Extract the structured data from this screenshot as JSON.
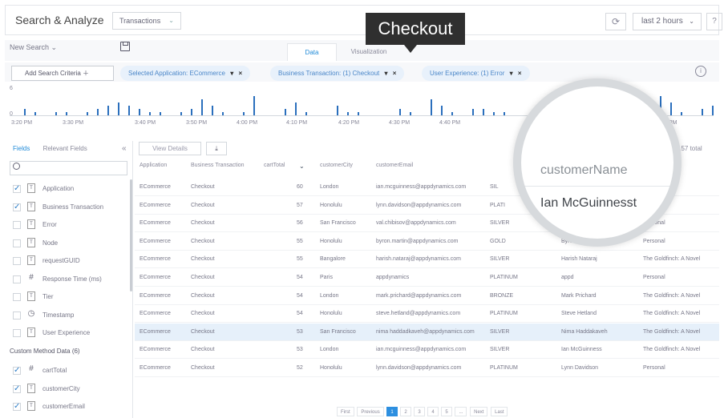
{
  "app": {
    "title": "Search & Analyze"
  },
  "header": {
    "transactions_label": "Transactions",
    "time_range": "last 2 hours",
    "help": "?"
  },
  "toolbar": {
    "new_search": "New Search",
    "tab_data": "Data",
    "tab_visualization": "Visualization"
  },
  "criteria": {
    "add_label": "Add Search Criteria",
    "chips": [
      "Selected Application: ECommerce",
      "Business Transaction: (1) Checkout",
      "User Experience: (1) Error"
    ]
  },
  "callout": {
    "text": "Checkout"
  },
  "histogram": {
    "y_ticks": [
      "6",
      "0"
    ],
    "x_ticks": [
      "3:20 PM",
      "3:30 PM",
      "3:40 PM",
      "3:50 PM",
      "4:00 PM",
      "4:10 PM",
      "4:20 PM",
      "4:30 PM",
      "4:40 PM",
      "PM"
    ]
  },
  "left_panel": {
    "tab_fields": "Fields",
    "tab_relevant": "Relevant Fields",
    "collapse": "«",
    "fields": [
      {
        "label": "Application",
        "checked": true,
        "icon": "T"
      },
      {
        "label": "Business Transaction",
        "checked": true,
        "icon": "T"
      },
      {
        "label": "Error",
        "checked": false,
        "icon": "T"
      },
      {
        "label": "Node",
        "checked": false,
        "icon": "T"
      },
      {
        "label": "requestGUID",
        "checked": false,
        "icon": "T"
      },
      {
        "label": "Response Time (ms)",
        "checked": false,
        "icon": "#"
      },
      {
        "label": "Tier",
        "checked": false,
        "icon": "T"
      },
      {
        "label": "Timestamp",
        "checked": false,
        "icon": "clock"
      },
      {
        "label": "User Experience",
        "checked": false,
        "icon": "T"
      }
    ],
    "custom_header": "Custom Method Data (6)",
    "custom_fields": [
      {
        "label": "cartTotal",
        "checked": true,
        "icon": "#"
      },
      {
        "label": "customerCity",
        "checked": true,
        "icon": "T"
      },
      {
        "label": "customerEmail",
        "checked": true,
        "icon": "T"
      }
    ]
  },
  "table": {
    "view_details": "View Details",
    "total": "157 total",
    "headers": [
      "Application",
      "Business Transaction",
      "cartTotal",
      "customerCity",
      "customerEmail"
    ],
    "rows": [
      [
        "ECommerce",
        "Checkout",
        "60",
        "London",
        "ian.mcguinness@appdynamics.com",
        "SIL",
        "",
        ""
      ],
      [
        "ECommerce",
        "Checkout",
        "57",
        "Honolulu",
        "lynn.davidson@appdynamics.com",
        "PLATI",
        "",
        "al"
      ],
      [
        "ECommerce",
        "Checkout",
        "56",
        "San Francisco",
        "val.chibisov@appdynamics.com",
        "SILVER",
        "",
        "Personal"
      ],
      [
        "ECommerce",
        "Checkout",
        "55",
        "Honolulu",
        "byron.martin@appdynamics.com",
        "GOLD",
        "Byron Martin",
        "Personal"
      ],
      [
        "ECommerce",
        "Checkout",
        "55",
        "Bangalore",
        "harish.nataraj@appdynamics.com",
        "SILVER",
        "Harish Nataraj",
        "The Goldfinch: A Novel"
      ],
      [
        "ECommerce",
        "Checkout",
        "54",
        "Paris",
        "appdynamics",
        "PLATINUM",
        "appd",
        "Personal"
      ],
      [
        "ECommerce",
        "Checkout",
        "54",
        "London",
        "mark.prichard@appdynamics.com",
        "BRONZE",
        "Mark Prichard",
        "The Goldfinch: A Novel"
      ],
      [
        "ECommerce",
        "Checkout",
        "54",
        "Honolulu",
        "steve.hetland@appdynamics.com",
        "PLATINUM",
        "Steve Hetland",
        "The Goldfinch: A Novel"
      ],
      [
        "ECommerce",
        "Checkout",
        "53",
        "San Francisco",
        "nima haddadkaveh@appdynamics.com",
        "SILVER",
        "Nima Haddakaveh",
        "The Goldfinch: A Novel"
      ],
      [
        "ECommerce",
        "Checkout",
        "53",
        "London",
        "ian.mcguinness@appdynamics.com",
        "SILVER",
        "Ian McGuinness",
        "The Goldfinch: A Novel"
      ],
      [
        "ECommerce",
        "Checkout",
        "52",
        "Honolulu",
        "lynn.davidson@appdynamics.com",
        "PLATINUM",
        "Lynn Davidson",
        "Personal"
      ]
    ],
    "selected_row": 8
  },
  "pager": {
    "first": "First",
    "previous": "Previous",
    "pages": [
      "1",
      "2",
      "3",
      "4",
      "5",
      "..."
    ],
    "next": "Next",
    "last": "Last"
  },
  "magnifier": {
    "header": "customerName",
    "value": "Ian McGuinnesst"
  }
}
